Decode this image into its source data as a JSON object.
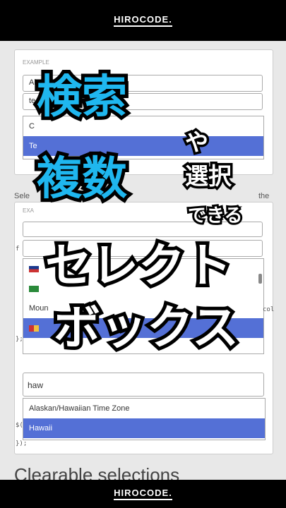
{
  "brand": "HIROCODE.",
  "example_label": "EXAMPLE",
  "top_select": {
    "value": "Al",
    "search_value": "te",
    "options": [
      "C",
      "Te"
    ]
  },
  "middle_text": "Sele",
  "middle_text_right": "the",
  "middle_example_label": "EXA",
  "code_lines": [
    "f",
    "};",
    "$(",
    "});"
  ],
  "dropdown_middle": {
    "items": [
      "Moun",
      "col"
    ]
  },
  "bottom_select": {
    "search_value": "haw",
    "options": [
      "Alaskan/Hawaiian Time Zone",
      "Hawaii"
    ]
  },
  "section_heading": "Clearable selections",
  "overlay": {
    "line1": "検索",
    "line1_suffix": "や",
    "line2": "複数",
    "line2_suffix_a": "選択",
    "line2_suffix_b": "できる",
    "line3": "セレクト",
    "line4": "ボックス"
  },
  "colors": {
    "accent": "#5470d6",
    "title_cyan": "#1fb7ef"
  }
}
